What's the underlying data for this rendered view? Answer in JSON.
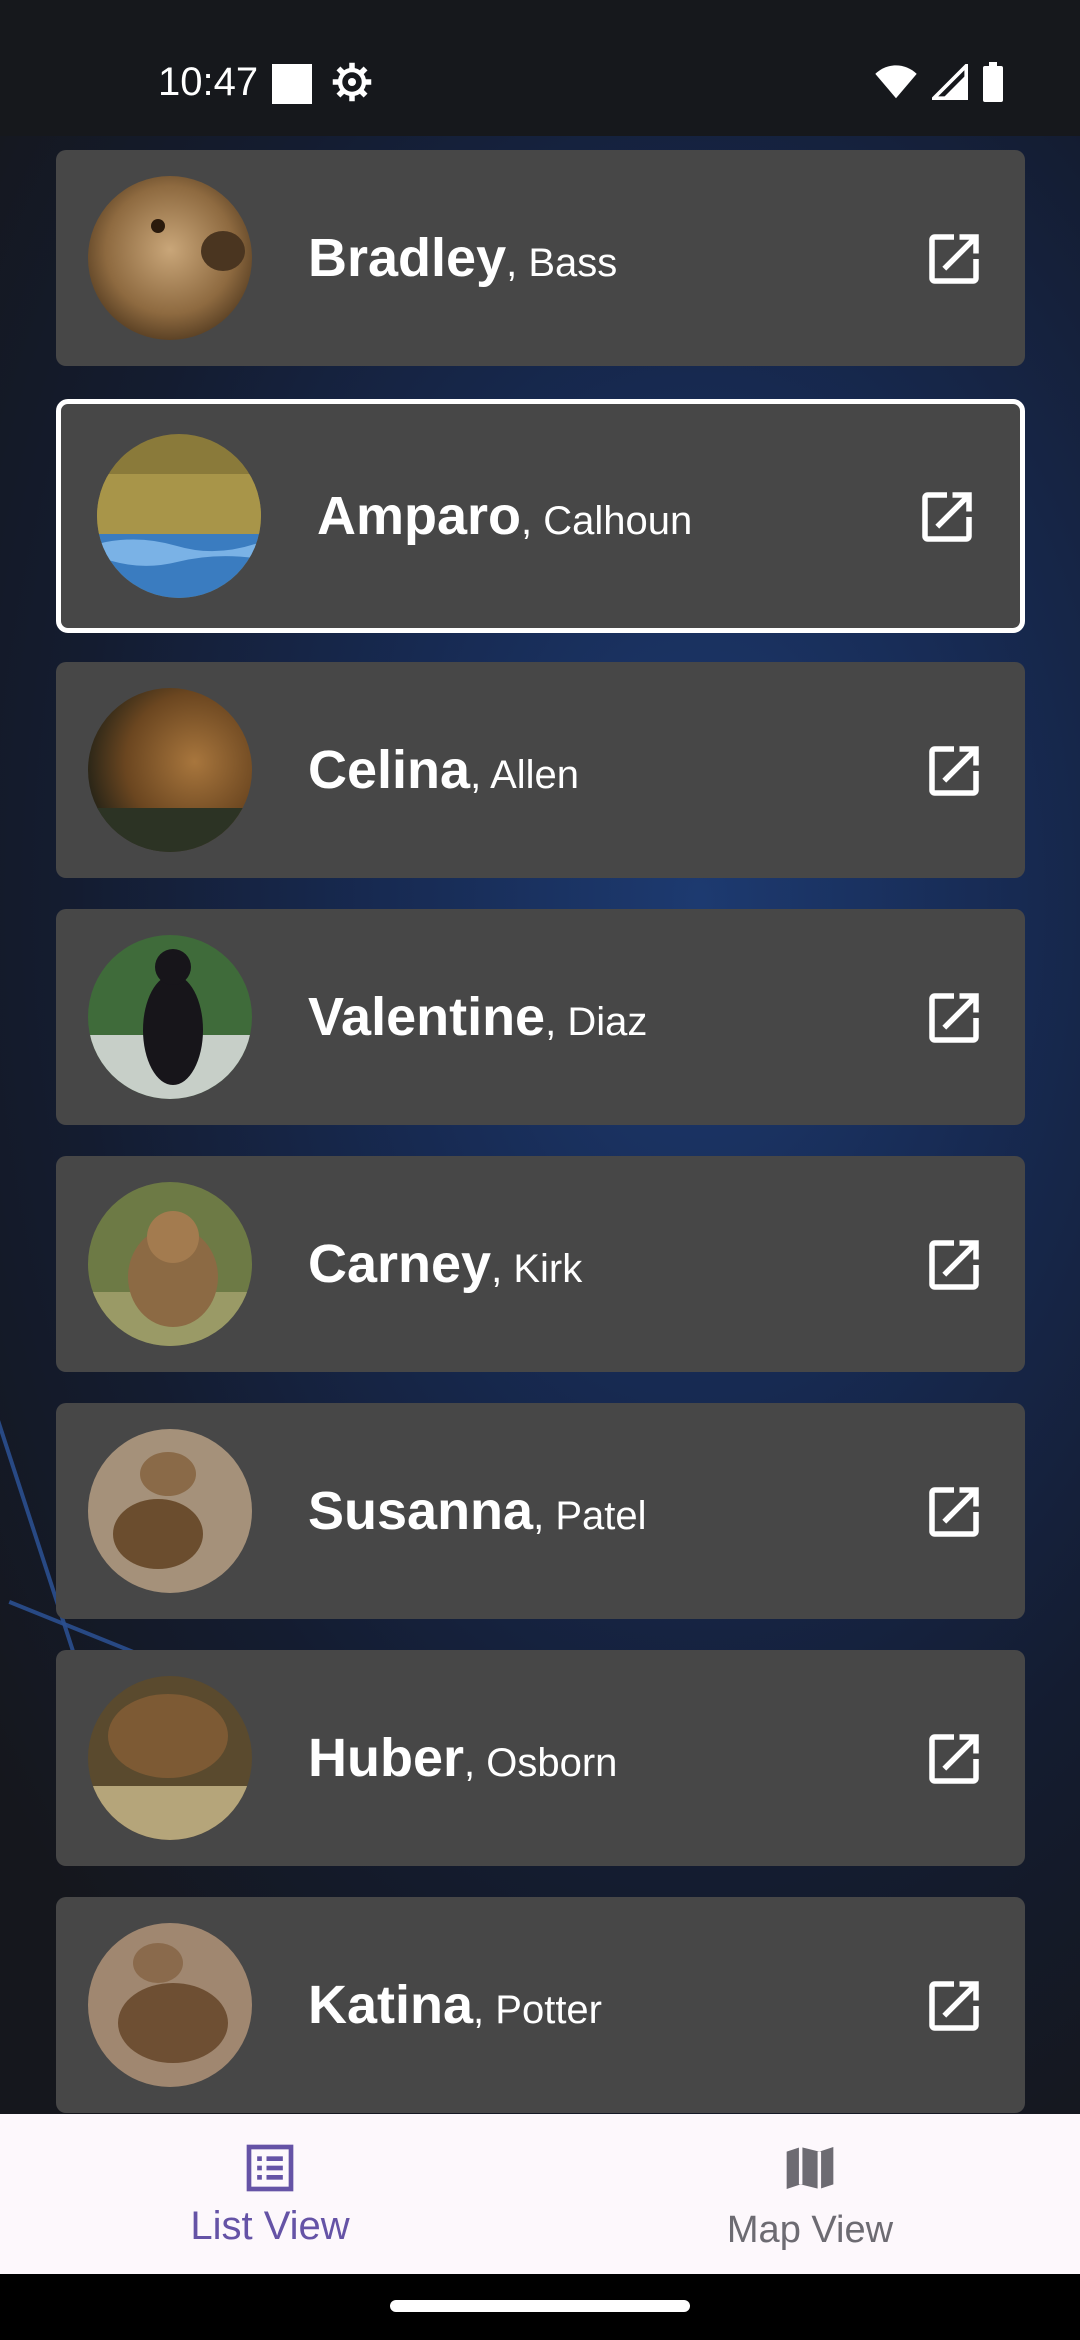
{
  "status_bar": {
    "time": "10:47",
    "icons": [
      "notification-square-icon",
      "settings-gear-icon",
      "wifi-icon",
      "signal-icon",
      "battery-icon"
    ]
  },
  "people": [
    {
      "first": "Bradley",
      "sep": ", ",
      "last": "Bass",
      "photo": "bear-photo"
    },
    {
      "first": "Amparo",
      "sep": ", ",
      "last": "Calhoun",
      "photo": "bear-photo"
    },
    {
      "first": "Celina",
      "sep": ", ",
      "last": "Allen",
      "photo": "bear-photo"
    },
    {
      "first": "Valentine",
      "sep": ", ",
      "last": "Diaz",
      "photo": "bear-photo"
    },
    {
      "first": "Carney",
      "sep": ", ",
      "last": "Kirk",
      "photo": "bear-photo"
    },
    {
      "first": "Susanna",
      "sep": ", ",
      "last": "Patel",
      "photo": "bear-photo"
    },
    {
      "first": "Huber",
      "sep": ", ",
      "last": "Osborn",
      "photo": "bear-photo"
    },
    {
      "first": "Katina",
      "sep": ", ",
      "last": "Potter",
      "photo": "bear-photo"
    }
  ],
  "selected_index": 1,
  "bottom_nav": {
    "list_label": "List View",
    "map_label": "Map View",
    "active": "List View"
  },
  "colors": {
    "card": "#474747",
    "accent": "#6553a6",
    "nav_bg": "#fdf8fc"
  }
}
